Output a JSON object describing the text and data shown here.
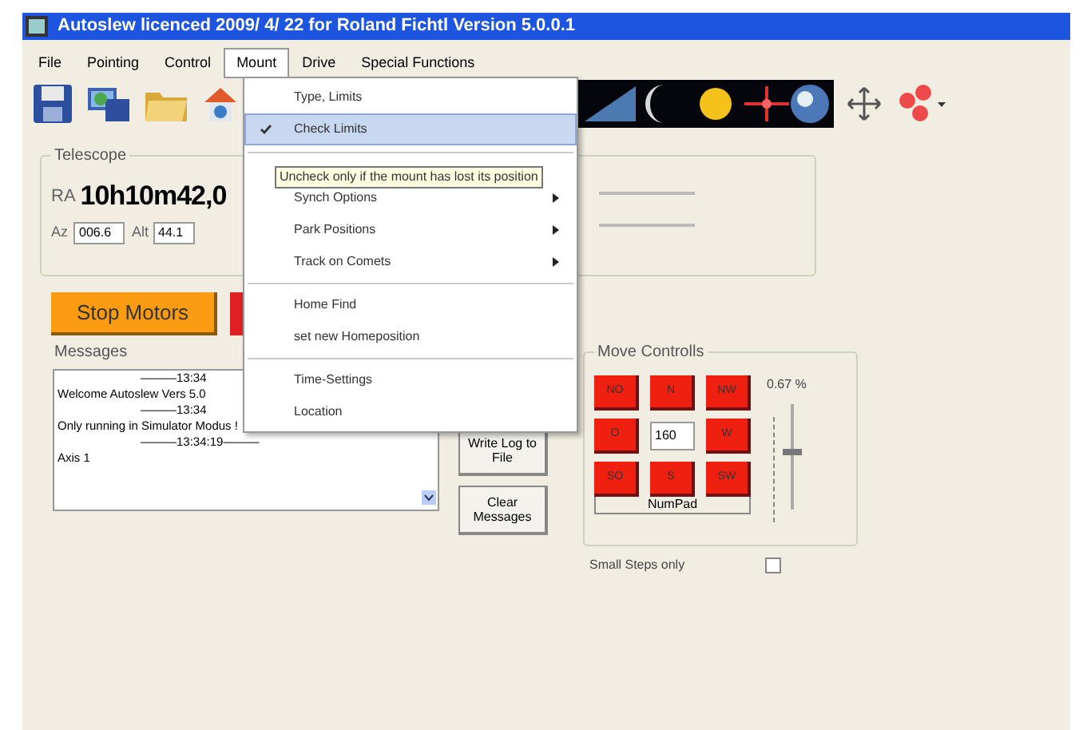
{
  "window": {
    "title": "Autoslew licenced  2009/ 4/ 22 for Roland Fichtl Version 5.0.0.1"
  },
  "menu_bar": [
    {
      "label": "File",
      "selected": false
    },
    {
      "label": "Pointing",
      "selected": false
    },
    {
      "label": "Control",
      "selected": false
    },
    {
      "label": "Mount",
      "selected": true
    },
    {
      "label": "Drive",
      "selected": false
    },
    {
      "label": "Special Functions",
      "selected": false
    }
  ],
  "mount_menu": [
    {
      "kind": "item",
      "label": "Type, Limits",
      "checked": false,
      "selected": false
    },
    {
      "kind": "item",
      "label": "Check Limits",
      "checked": true,
      "selected": true
    },
    {
      "kind": "separator"
    },
    {
      "kind": "submenu",
      "label": "Synch Options",
      "checked": false,
      "selected": false
    },
    {
      "kind": "submenu",
      "label": "Park Positions",
      "checked": false,
      "selected": false
    },
    {
      "kind": "submenu",
      "label": "Track on Comets",
      "checked": false,
      "selected": false
    },
    {
      "kind": "separator"
    },
    {
      "kind": "item",
      "label": "Home Find",
      "checked": false,
      "selected": false
    },
    {
      "kind": "item",
      "label": "set new Homeposition",
      "checked": false,
      "selected": false
    },
    {
      "kind": "separator"
    },
    {
      "kind": "item",
      "label": "Time-Settings",
      "checked": false,
      "selected": false
    },
    {
      "kind": "item",
      "label": "Location",
      "checked": false,
      "selected": false
    }
  ],
  "tooltip": "Uncheck only if the mount has lost its position",
  "telescope": {
    "title": "Telescope",
    "ra_label": "RA",
    "ra": "10h10m42,0",
    "az_label": "Az",
    "az": "006.6",
    "alt_label": "Alt",
    "alt": "44.1"
  },
  "stop_button": "Stop Motors",
  "messages": {
    "title": "Messages",
    "lines": [
      {
        "kind": "time",
        "text": "———13:34"
      },
      {
        "kind": "text",
        "text": "Welcome Autoslew Vers 5.0"
      },
      {
        "kind": "time",
        "text": "———13:34"
      },
      {
        "kind": "text",
        "text": "Only running in Simulator Modus !"
      },
      {
        "kind": "time",
        "text": "———13:34:19———"
      },
      {
        "kind": "text",
        "text": "Axis 1"
      }
    ]
  },
  "log_buttons": [
    "Write Log to File",
    "Clear Messages"
  ],
  "move_controls": {
    "title": "Move Controlls",
    "pad": [
      {
        "kind": "button",
        "label": "NO"
      },
      {
        "kind": "button",
        "label": "N"
      },
      {
        "kind": "button",
        "label": "NW"
      },
      {
        "kind": "button",
        "label": "O"
      },
      {
        "kind": "field",
        "label": "160"
      },
      {
        "kind": "button",
        "label": "W"
      },
      {
        "kind": "button",
        "label": "SO"
      },
      {
        "kind": "button",
        "label": "S"
      },
      {
        "kind": "button",
        "label": "SW"
      }
    ],
    "numpad": "NumPad",
    "speed": "0.67 %",
    "slider": {
      "level": 0.55
    },
    "small_steps": {
      "label": "Small Steps only",
      "checked": false
    }
  }
}
